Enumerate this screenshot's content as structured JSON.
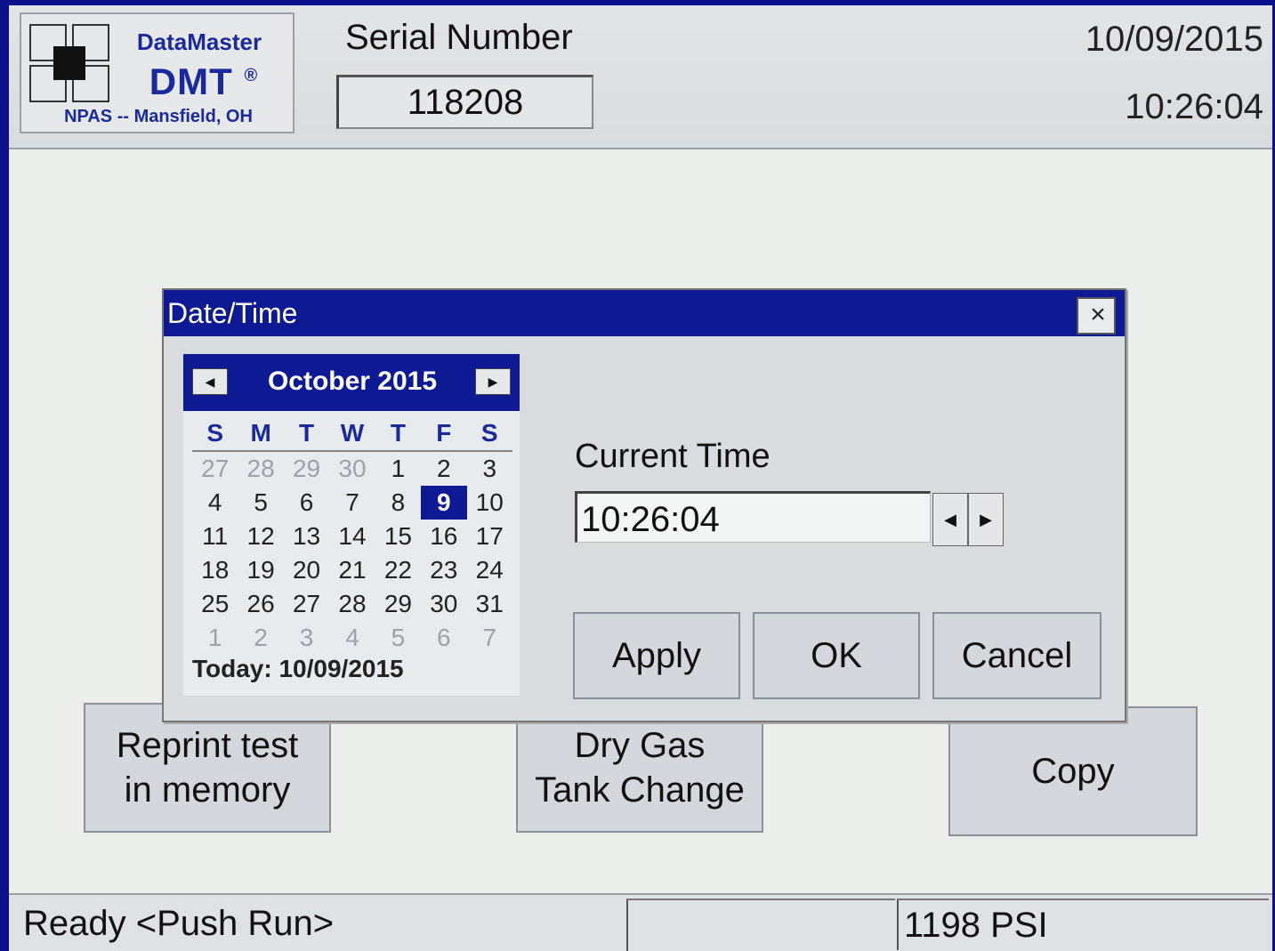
{
  "header": {
    "logo": {
      "brand": "DataMaster",
      "model": "DMT",
      "registered": "®",
      "subtitle": "NPAS -- Mansfield, OH"
    },
    "serial_label": "Serial Number",
    "serial_value": "118208",
    "date": "10/09/2015",
    "time": "10:26:04"
  },
  "main_buttons": {
    "reprint": [
      "Reprint test",
      "in memory"
    ],
    "dry_gas": [
      "Dry Gas",
      "Tank Change"
    ],
    "copy": "Copy"
  },
  "status_bar": {
    "message": "Ready <Push Run>",
    "middle": "",
    "pressure": "1198 PSI"
  },
  "dialog": {
    "title": "Date/Time",
    "close_glyph": "×",
    "calendar": {
      "month_year": "October 2015",
      "prev_glyph": "◀",
      "next_glyph": "▶",
      "weekdays": [
        "S",
        "M",
        "T",
        "W",
        "T",
        "F",
        "S"
      ],
      "weeks": [
        [
          {
            "d": "27",
            "o": true
          },
          {
            "d": "28",
            "o": true
          },
          {
            "d": "29",
            "o": true
          },
          {
            "d": "30",
            "o": true
          },
          {
            "d": "1"
          },
          {
            "d": "2"
          },
          {
            "d": "3"
          }
        ],
        [
          {
            "d": "4"
          },
          {
            "d": "5"
          },
          {
            "d": "6"
          },
          {
            "d": "7"
          },
          {
            "d": "8"
          },
          {
            "d": "9",
            "s": true
          },
          {
            "d": "10"
          }
        ],
        [
          {
            "d": "11"
          },
          {
            "d": "12"
          },
          {
            "d": "13"
          },
          {
            "d": "14"
          },
          {
            "d": "15"
          },
          {
            "d": "16"
          },
          {
            "d": "17"
          }
        ],
        [
          {
            "d": "18"
          },
          {
            "d": "19"
          },
          {
            "d": "20"
          },
          {
            "d": "21"
          },
          {
            "d": "22"
          },
          {
            "d": "23"
          },
          {
            "d": "24"
          }
        ],
        [
          {
            "d": "25"
          },
          {
            "d": "26"
          },
          {
            "d": "27"
          },
          {
            "d": "28"
          },
          {
            "d": "29"
          },
          {
            "d": "30"
          },
          {
            "d": "31"
          }
        ],
        [
          {
            "d": "1",
            "o": true
          },
          {
            "d": "2",
            "o": true
          },
          {
            "d": "3",
            "o": true
          },
          {
            "d": "4",
            "o": true
          },
          {
            "d": "5",
            "o": true
          },
          {
            "d": "6",
            "o": true
          },
          {
            "d": "7",
            "o": true
          }
        ]
      ],
      "today_label": "Today: 10/09/2015"
    },
    "current_time_label": "Current Time",
    "current_time_value": "10:26:04",
    "spin_down_glyph": "◀",
    "spin_up_glyph": "▶",
    "buttons": {
      "apply": "Apply",
      "ok": "OK",
      "cancel": "Cancel"
    }
  },
  "colors": {
    "bezel": "#0c0f8a",
    "title_bar": "#0e1a94",
    "screen_bg": "#eceeec",
    "button_bg": "#d4d8dc"
  }
}
